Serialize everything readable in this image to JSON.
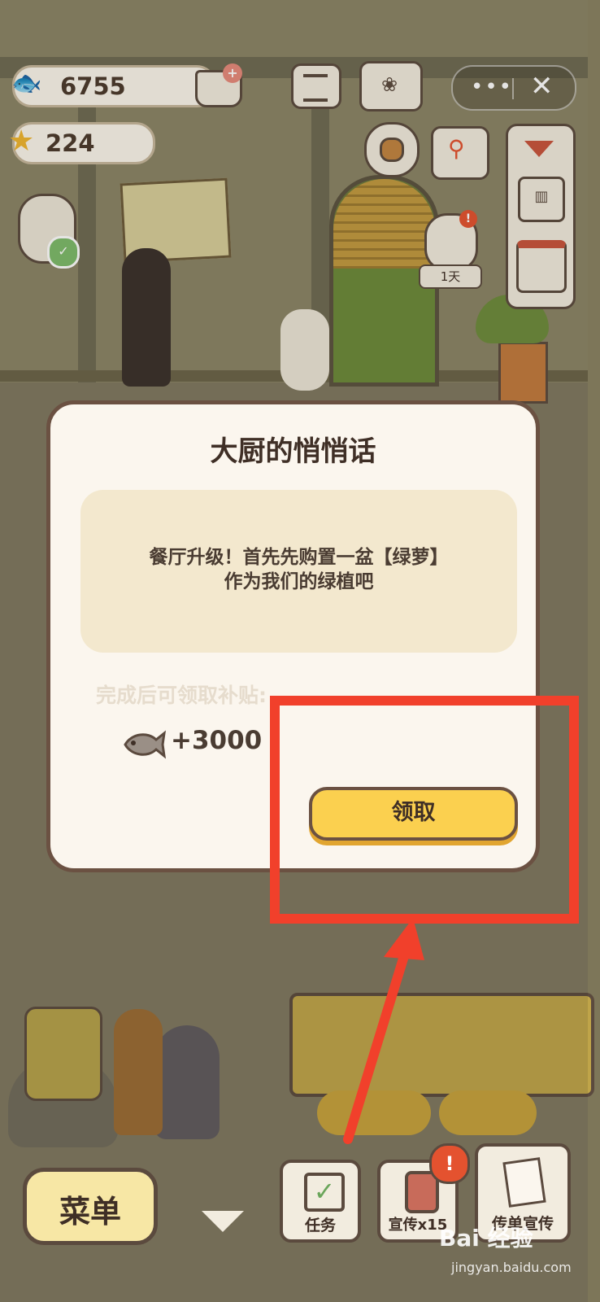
{
  "hud": {
    "fish_count": "6755",
    "star_count": "224",
    "day_badge": "1天"
  },
  "capsule": {
    "more_glyph": "•••",
    "close_glyph": "✕"
  },
  "dialog": {
    "title": "大厨的悄悄话",
    "message_line1": "餐厅升级！首先先购置一盆【绿萝】",
    "message_line2": "作为我们的绿植吧",
    "reward_label": "完成后可领取补贴:",
    "reward_amount": "+3000",
    "claim_button": "领取"
  },
  "bottom_bar": {
    "menu_label": "菜单",
    "tasks_label": "任务",
    "promote_label": "宣传x15",
    "flyer_label": "传单宣传"
  },
  "watermark": {
    "brand": "Bai 经验",
    "url": "jingyan.baidu.com"
  },
  "annotation": {
    "highlight_color": "#f1402b"
  }
}
